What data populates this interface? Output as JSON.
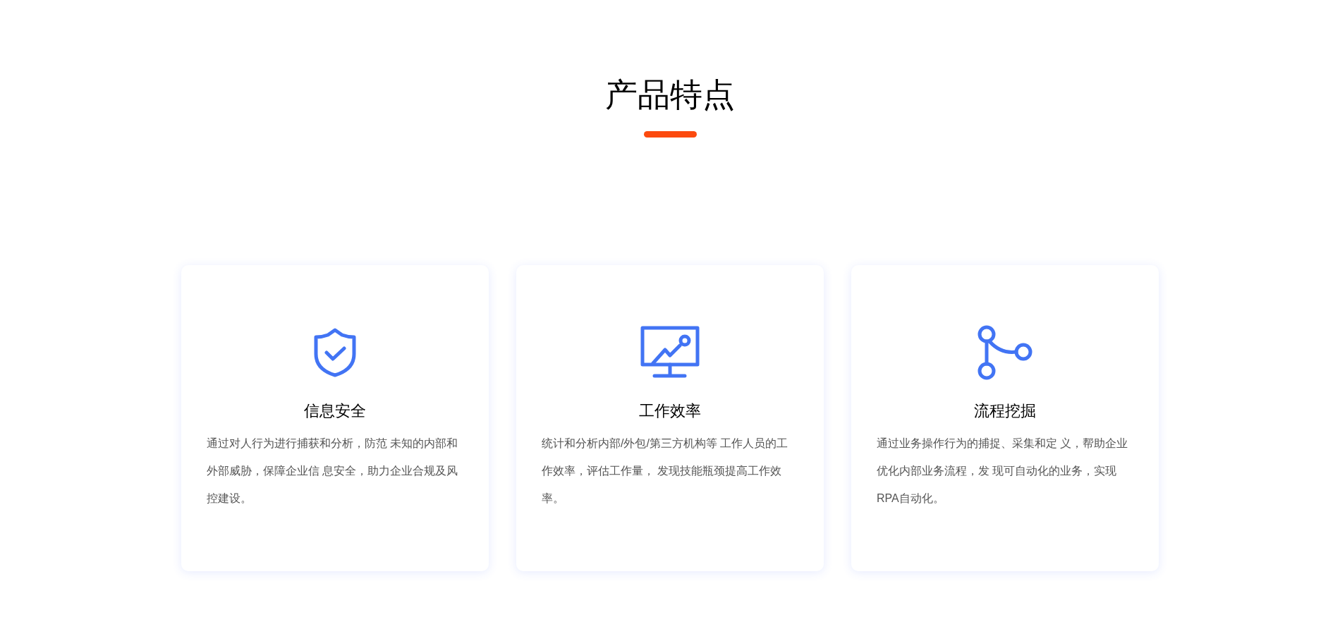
{
  "section": {
    "title": "产品特点"
  },
  "features": [
    {
      "kind": "shield",
      "title": "信息安全",
      "description": "通过对人行为进行捕获和分析，防范 未知的内部和外部威胁，保障企业信 息安全，助力企业合规及风控建设。"
    },
    {
      "kind": "monitor",
      "title": "工作效率",
      "description": "统计和分析内部/外包/第三方机构等 工作人员的工作效率，评估工作量， 发现技能瓶颈提高工作效率。"
    },
    {
      "kind": "flow",
      "title": "流程挖掘",
      "description": "通过业务操作行为的捕捉、采集和定 义，帮助企业优化内部业务流程，发 现可自动化的业务，实现RPA自动化。"
    }
  ]
}
